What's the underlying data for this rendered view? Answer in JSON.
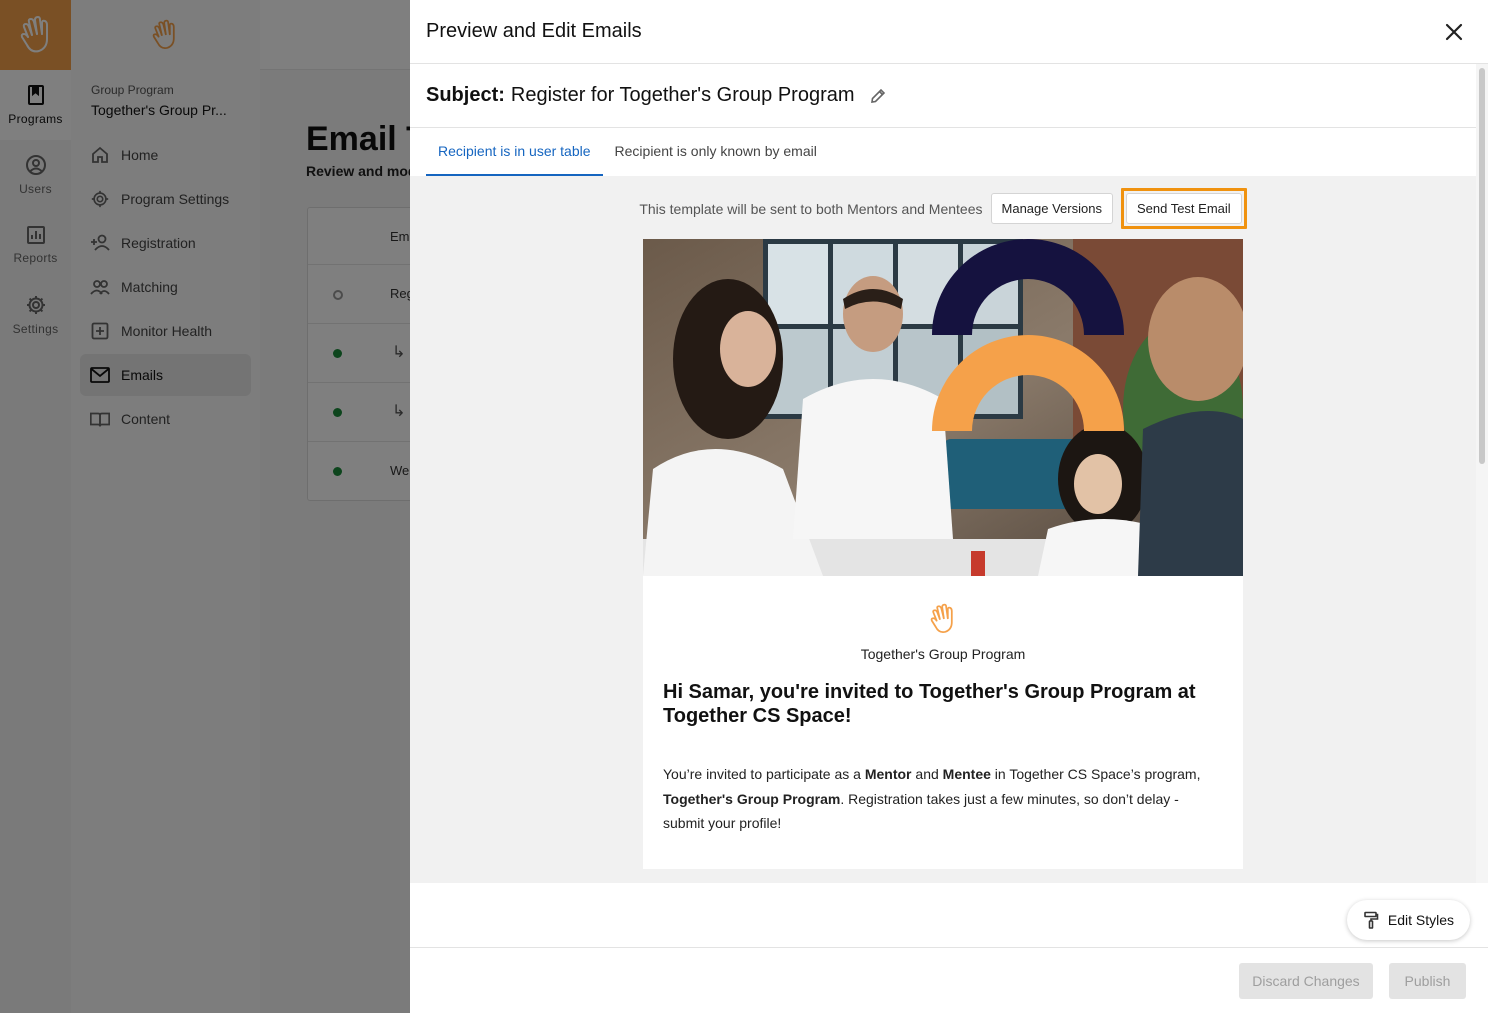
{
  "rail": {
    "items": [
      {
        "label": "Programs",
        "icon": "bookmark-icon"
      },
      {
        "label": "Users",
        "icon": "user-circle-icon"
      },
      {
        "label": "Reports",
        "icon": "bar-chart-icon"
      },
      {
        "label": "Settings",
        "icon": "gear-icon"
      }
    ]
  },
  "nav": {
    "subtitle": "Group Program",
    "program_name": "Together's Group Pr...",
    "items": [
      {
        "label": "Home",
        "icon": "home-icon"
      },
      {
        "label": "Program Settings",
        "icon": "gear-icon"
      },
      {
        "label": "Registration",
        "icon": "person-add-icon"
      },
      {
        "label": "Matching",
        "icon": "people-icon"
      },
      {
        "label": "Monitor Health",
        "icon": "medical-plus-icon"
      },
      {
        "label": "Emails",
        "icon": "mail-icon"
      },
      {
        "label": "Content",
        "icon": "book-icon"
      }
    ]
  },
  "main": {
    "title": "Email T",
    "description": "Review and mod",
    "table": {
      "header": "Ema",
      "rows": [
        {
          "text": "Reg",
          "status": "draft"
        },
        {
          "text": "",
          "status": "active"
        },
        {
          "text": "",
          "status": "active"
        },
        {
          "text": "We",
          "status": "active"
        }
      ]
    }
  },
  "drawer": {
    "title": "Preview and Edit Emails",
    "subject_label": "Subject:",
    "subject_text": "Register for Together's Group Program",
    "tabs": [
      {
        "label": "Recipient is in user table",
        "active": true
      },
      {
        "label": "Recipient is only known by email",
        "active": false
      }
    ],
    "toolbar": {
      "note": "This template will be sent to both Mentors and Mentees",
      "manage_versions": "Manage Versions",
      "send_test": "Send Test Email"
    },
    "email": {
      "program_name": "Together's Group Program",
      "headline": "Hi Samar, you're invited to Together's Group Program at Together CS Space!",
      "body_parts": {
        "p1": "You’re invited to participate as a ",
        "mentor": "Mentor",
        "and": " and ",
        "mentee": "Mentee",
        "p2": " in Together CS Space’s program, ",
        "program": "Together's Group Program",
        "p3": ". Registration takes just a few minutes, so don’t delay - submit your profile!"
      }
    },
    "edit_styles": "Edit Styles",
    "footer": {
      "discard": "Discard Changes",
      "publish": "Publish"
    }
  },
  "colors": {
    "brand_orange": "#f5a14a",
    "highlight_orange": "#f0920f",
    "tab_blue": "#1565c0",
    "arch_navy": "#15123f",
    "status_green": "#1a8a3a"
  }
}
